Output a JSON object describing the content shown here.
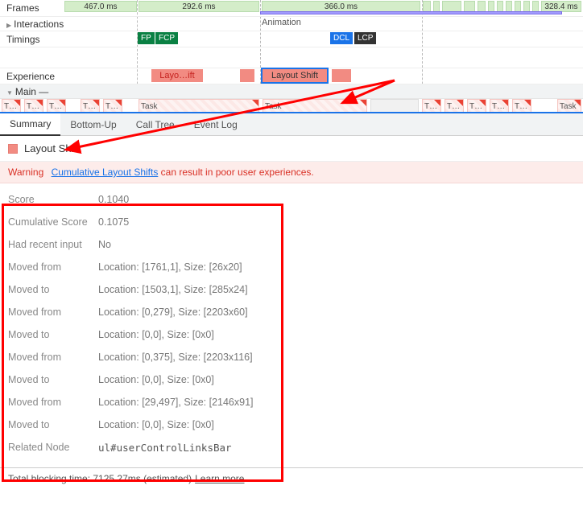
{
  "tracks": {
    "frames": {
      "label": "Frames",
      "items": [
        "467.0 ms",
        "292.6 ms",
        "366.0 ms",
        "328.4 ms"
      ]
    },
    "interactions": {
      "label": "Interactions",
      "animation": "Animation"
    },
    "timings": {
      "label": "Timings",
      "badges": {
        "fp": "FP",
        "fcp": "FCP",
        "dcl": "DCL",
        "lcp": "LCP"
      }
    },
    "experience": {
      "label": "Experience",
      "items": {
        "layout_trunc": "Layo…ift",
        "layout_shift": "Layout Shift"
      }
    },
    "main": {
      "label": "Main —",
      "task": "Task",
      "task_trunc": "T…"
    }
  },
  "tabs": {
    "summary": "Summary",
    "bottomup": "Bottom-Up",
    "calltree": "Call Tree",
    "eventlog": "Event Log"
  },
  "summary": {
    "title": "Layout Shift",
    "warning_label": "Warning",
    "warning_link": "Cumulative Layout Shifts",
    "warning_rest": " can result in poor user experiences.",
    "rows": [
      {
        "k": "Score",
        "v": "0.1040"
      },
      {
        "k": "Cumulative Score",
        "v": "0.1075"
      },
      {
        "k": "Had recent input",
        "v": "No"
      },
      {
        "k": "Moved from",
        "v": "Location: [1761,1], Size: [26x20]"
      },
      {
        "k": "Moved to",
        "v": "Location: [1503,1], Size: [285x24]"
      },
      {
        "k": "Moved from",
        "v": "Location: [0,279], Size: [2203x60]"
      },
      {
        "k": "Moved to",
        "v": "Location: [0,0], Size: [0x0]"
      },
      {
        "k": "Moved from",
        "v": "Location: [0,375], Size: [2203x116]"
      },
      {
        "k": "Moved to",
        "v": "Location: [0,0], Size: [0x0]"
      },
      {
        "k": "Moved from",
        "v": "Location: [29,497], Size: [2146x91]"
      },
      {
        "k": "Moved to",
        "v": "Location: [0,0], Size: [0x0]"
      },
      {
        "k": "Related Node",
        "v": "ul#userControlLinksBar",
        "code": true
      }
    ]
  },
  "footer": {
    "text": "Total blocking time: 7125.27ms (estimated)",
    "learn": "Learn more"
  }
}
